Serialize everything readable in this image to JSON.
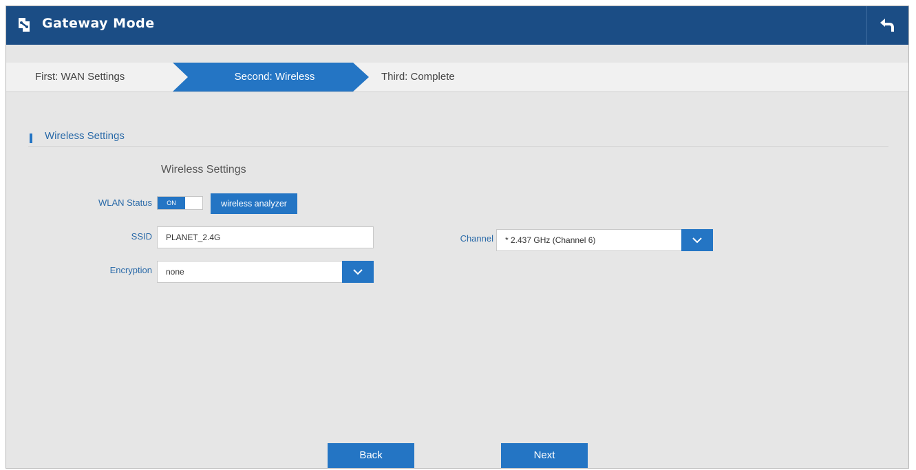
{
  "header": {
    "title": "Gateway Mode",
    "logo_icon": "gateway-logo-icon",
    "back_icon": "return-arrow-icon",
    "bg_color": "#1b4d85"
  },
  "steps": [
    {
      "label": "First: WAN Settings",
      "active": false
    },
    {
      "label": "Second: Wireless",
      "active": true
    },
    {
      "label": "Third: Complete",
      "active": false
    }
  ],
  "section": {
    "title": "Wireless Settings"
  },
  "form": {
    "title": "Wireless Settings",
    "wlan_status": {
      "label": "WLAN Status",
      "toggle_text": "ON",
      "enabled": true
    },
    "analyzer_button": "wireless analyzer",
    "ssid": {
      "label": "SSID",
      "value": "PLANET_2.4G"
    },
    "encryption": {
      "label": "Encryption",
      "value": "none"
    },
    "channel": {
      "label": "Channel",
      "value": "* 2.437 GHz (Channel 6)"
    }
  },
  "buttons": {
    "back": "Back",
    "next": "Next"
  },
  "accent_color": "#2475c4"
}
